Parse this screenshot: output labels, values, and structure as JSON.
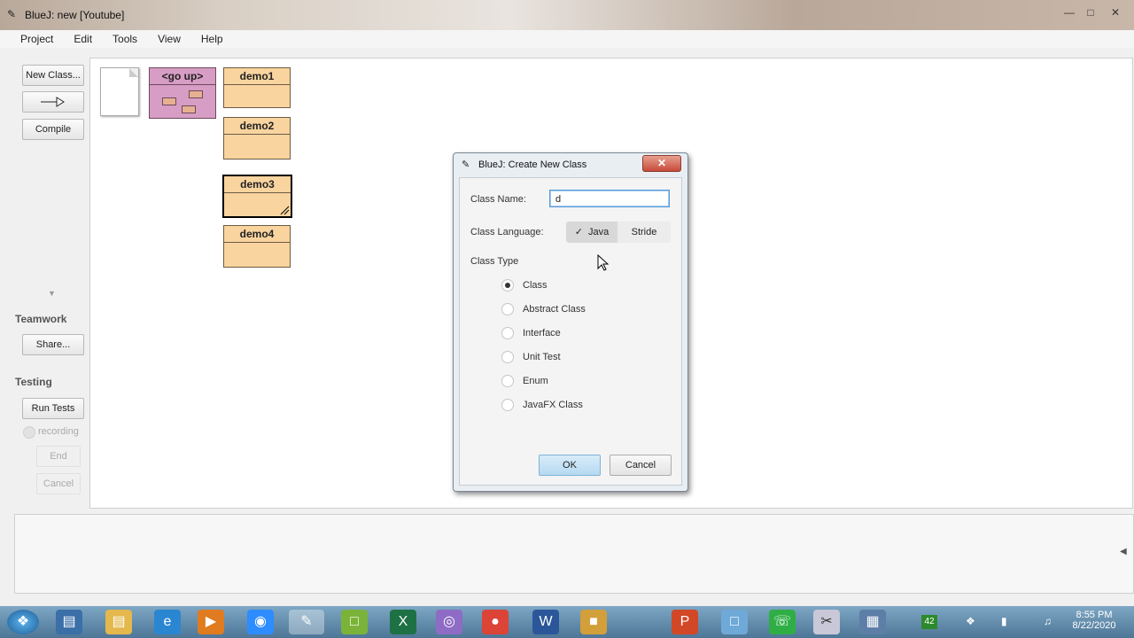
{
  "window": {
    "title": "BlueJ:  new  [Youtube]",
    "app_icon": "bluej-bird-icon",
    "controls": [
      "minimize-icon",
      "maximize-icon",
      "close-icon"
    ]
  },
  "menu": [
    "Project",
    "Edit",
    "Tools",
    "View",
    "Help"
  ],
  "sidebar": {
    "new_class": "New Class...",
    "compile": "Compile",
    "teamwork_label": "Teamwork",
    "share": "Share...",
    "testing_label": "Testing",
    "run_tests": "Run Tests",
    "recording": "recording",
    "end": "End",
    "cancel": "Cancel"
  },
  "canvas": {
    "go_up": "<go up>",
    "classes": [
      "demo1",
      "demo2",
      "demo3",
      "demo4"
    ]
  },
  "dialog": {
    "title": "BlueJ:  Create New Class",
    "class_name_label": "Class Name:",
    "class_name_value": "d",
    "class_language_label": "Class Language:",
    "lang_java": "Java",
    "lang_stride": "Stride",
    "lang_selected": "Java",
    "class_type_label": "Class Type",
    "class_types": [
      "Class",
      "Abstract Class",
      "Interface",
      "Unit Test",
      "Enum",
      "JavaFX Class"
    ],
    "selected_type": "Class",
    "ok": "OK",
    "cancel": "Cancel"
  },
  "taskbar": {
    "time": "8:55 PM",
    "date": "8/22/2020",
    "notification_badge": "42"
  },
  "colors": {
    "class_fill": "#f9d49f",
    "package_fill": "#d79dc4",
    "dialog_bg": "#f4f4f4"
  }
}
